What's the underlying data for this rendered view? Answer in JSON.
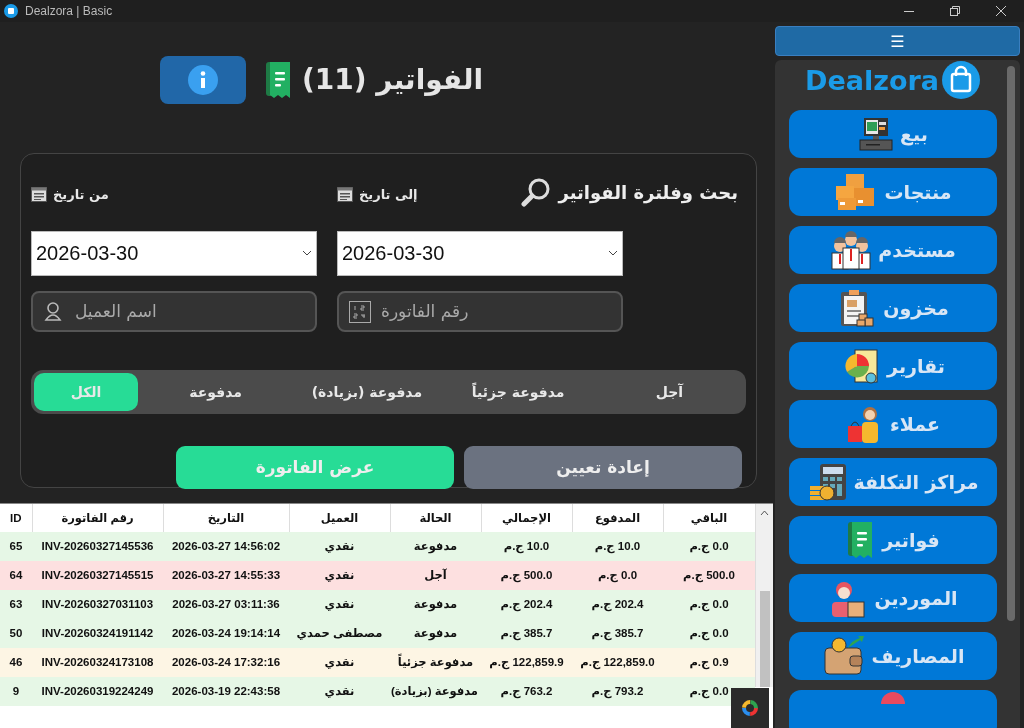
{
  "window": {
    "title": "Dealzora | Basic"
  },
  "header": {
    "title": "الفواتير (11)"
  },
  "filter": {
    "heading": "بحث وفلترة الفواتير",
    "to_label": "إلى تاريخ",
    "from_label": "من تاريخ",
    "from_date": "2026-03-30",
    "to_date": "2026-03-30",
    "customer_placeholder": "اسم العميل",
    "invoice_placeholder": "رقم الفاتورة",
    "statuses": [
      {
        "label": "آجل",
        "selected": false
      },
      {
        "label": "مدفوعة جزئياً",
        "selected": false
      },
      {
        "label": "مدفوعة (بزيادة)",
        "selected": false
      },
      {
        "label": "مدفوعة",
        "selected": false
      },
      {
        "label": "الكل",
        "selected": true
      }
    ],
    "buttons": [
      {
        "label": "إعادة تعيين",
        "kind": "reset"
      },
      {
        "label": "عرض الفاتورة",
        "kind": "view"
      }
    ]
  },
  "table": {
    "columns": [
      "الباقي",
      "المدفوع",
      "الإجمالي",
      "الحالة",
      "العميل",
      "التاريخ",
      "رقم الفاتورة",
      "ID"
    ],
    "rows": [
      {
        "kind": "paid",
        "cells": [
          "0.0 ج.م",
          "10.0 ج.م",
          "10.0 ج.م",
          "مدفوعة",
          "نقدي",
          "2026-03-27 14:56:02",
          "INV-20260327145536",
          "65"
        ]
      },
      {
        "kind": "deferred",
        "cells": [
          "500.0 ج.م",
          "0.0 ج.م",
          "500.0 ج.م",
          "آجل",
          "نقدي",
          "2026-03-27 14:55:33",
          "INV-20260327145515",
          "64"
        ]
      },
      {
        "kind": "paid",
        "cells": [
          "0.0 ج.م",
          "202.4 ج.م",
          "202.4 ج.م",
          "مدفوعة",
          "نقدي",
          "2026-03-27 03:11:36",
          "INV-20260327031103",
          "63"
        ]
      },
      {
        "kind": "paid",
        "cells": [
          "0.0 ج.م",
          "385.7 ج.م",
          "385.7 ج.م",
          "مدفوعة",
          "مصطفى حمدي",
          "2026-03-24 19:14:14",
          "INV-20260324191142",
          "50"
        ]
      },
      {
        "kind": "partial",
        "cells": [
          "0.9 ج.م",
          "122,859.0 ج.م",
          "122,859.9 ج.م",
          "مدفوعة جزئياً",
          "نقدي",
          "2026-03-24 17:32:16",
          "INV-20260324173108",
          "46"
        ]
      },
      {
        "kind": "overpaid",
        "cells": [
          "0.0 ج.م",
          "793.2 ج.م",
          "763.2 ج.م",
          "مدفوعة (بزيادة)",
          "نقدي",
          "2026-03-19 22:43:58",
          "INV-20260319224249",
          "9"
        ]
      }
    ]
  },
  "sidebar": {
    "menu": "☰",
    "logo": "Dealzora",
    "items": [
      "بيع",
      "منتجات",
      "مستخدم",
      "مخزون",
      "تقارير",
      "عملاء",
      "مراكز التكلفة",
      "فواتير",
      "الموردين",
      "المصاريف"
    ]
  }
}
